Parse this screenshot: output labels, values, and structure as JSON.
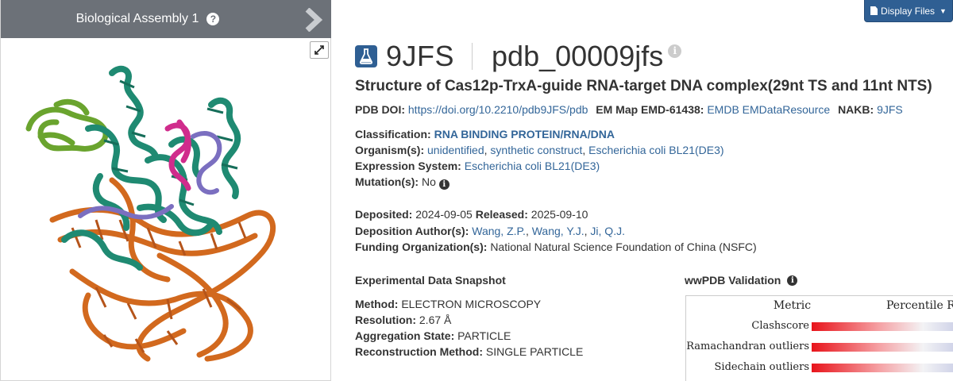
{
  "assembly": {
    "title": "Biological Assembly 1",
    "help_glyph": "?"
  },
  "display_files": {
    "label": "Display Files"
  },
  "entry": {
    "id": "9JFS",
    "pdb_id": "pdb_00009jfs",
    "title": "Structure of Cas12p-TrxA-guide RNA-target DNA complex(29nt TS and 11nt NTS)"
  },
  "identifiers": {
    "doi_label": "PDB DOI:",
    "doi_value": "https://doi.org/10.2210/pdb9JFS/pdb",
    "em_map_label": "EM Map EMD-61438:",
    "em_link_1": "EMDB",
    "em_link_2": "EMDataResource",
    "nakb_label": "NAKB:",
    "nakb_value": "9JFS"
  },
  "classification": {
    "classification_label": "Classification:",
    "classification_value": "RNA BINDING PROTEIN/RNA/DNA",
    "organism_label": "Organism(s):",
    "organisms": [
      "unidentified",
      "synthetic construct",
      "Escherichia coli BL21(DE3)"
    ],
    "expression_label": "Expression System:",
    "expression_value": "Escherichia coli BL21(DE3)",
    "mutation_label": "Mutation(s):",
    "mutation_value": "No"
  },
  "deposition": {
    "deposited_label": "Deposited:",
    "deposited_value": "2024-09-05",
    "released_label": "Released:",
    "released_value": "2025-09-10",
    "authors_label": "Deposition Author(s):",
    "authors": [
      "Wang, Z.P.",
      "Wang, Y.J.",
      "Ji, Q.J."
    ],
    "funding_label": "Funding Organization(s):",
    "funding_value": "National Natural Science Foundation of China (NSFC)"
  },
  "experimental": {
    "heading": "Experimental Data Snapshot",
    "method_label": "Method:",
    "method_value": "ELECTRON MICROSCOPY",
    "resolution_label": "Resolution:",
    "resolution_value": "2.67 Å",
    "aggregation_label": "Aggregation State:",
    "aggregation_value": "PARTICLE",
    "reconstruction_label": "Reconstruction Method:",
    "reconstruction_value": "SINGLE PARTICLE"
  },
  "validation": {
    "heading": "wwPDB Validation",
    "metric_header": "Metric",
    "percentile_header": "Percentile R",
    "metrics": [
      "Clashscore",
      "Ramachandran outliers",
      "Sidechain outliers"
    ]
  },
  "colors": {
    "header_gray": "#6c7178",
    "brand_blue": "#2f5f93",
    "link": "#336699",
    "protein_teal": "#1f8a72",
    "protein_green": "#6aa42e",
    "dna_orange": "#d2691e",
    "rna_purple": "#7b6fc0",
    "rna_magenta": "#d02c8c"
  }
}
